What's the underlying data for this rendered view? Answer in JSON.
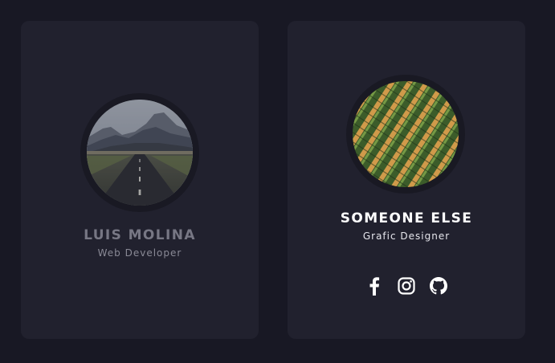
{
  "cards": [
    {
      "name": "LUIS MOLINA",
      "role": "Web Developer",
      "avatar": "road-mountains-photo"
    },
    {
      "name": "SOMEONE ELSE",
      "role": "Grafic Designer",
      "avatar": "field-rows-photo",
      "socials": [
        {
          "icon": "facebook-icon"
        },
        {
          "icon": "instagram-icon"
        },
        {
          "icon": "github-icon"
        }
      ]
    }
  ],
  "colors": {
    "page_background": "#181824",
    "card_background": "#21212e",
    "ring": "#191923",
    "active_text": "#ffffff",
    "muted_text": "#777784"
  }
}
